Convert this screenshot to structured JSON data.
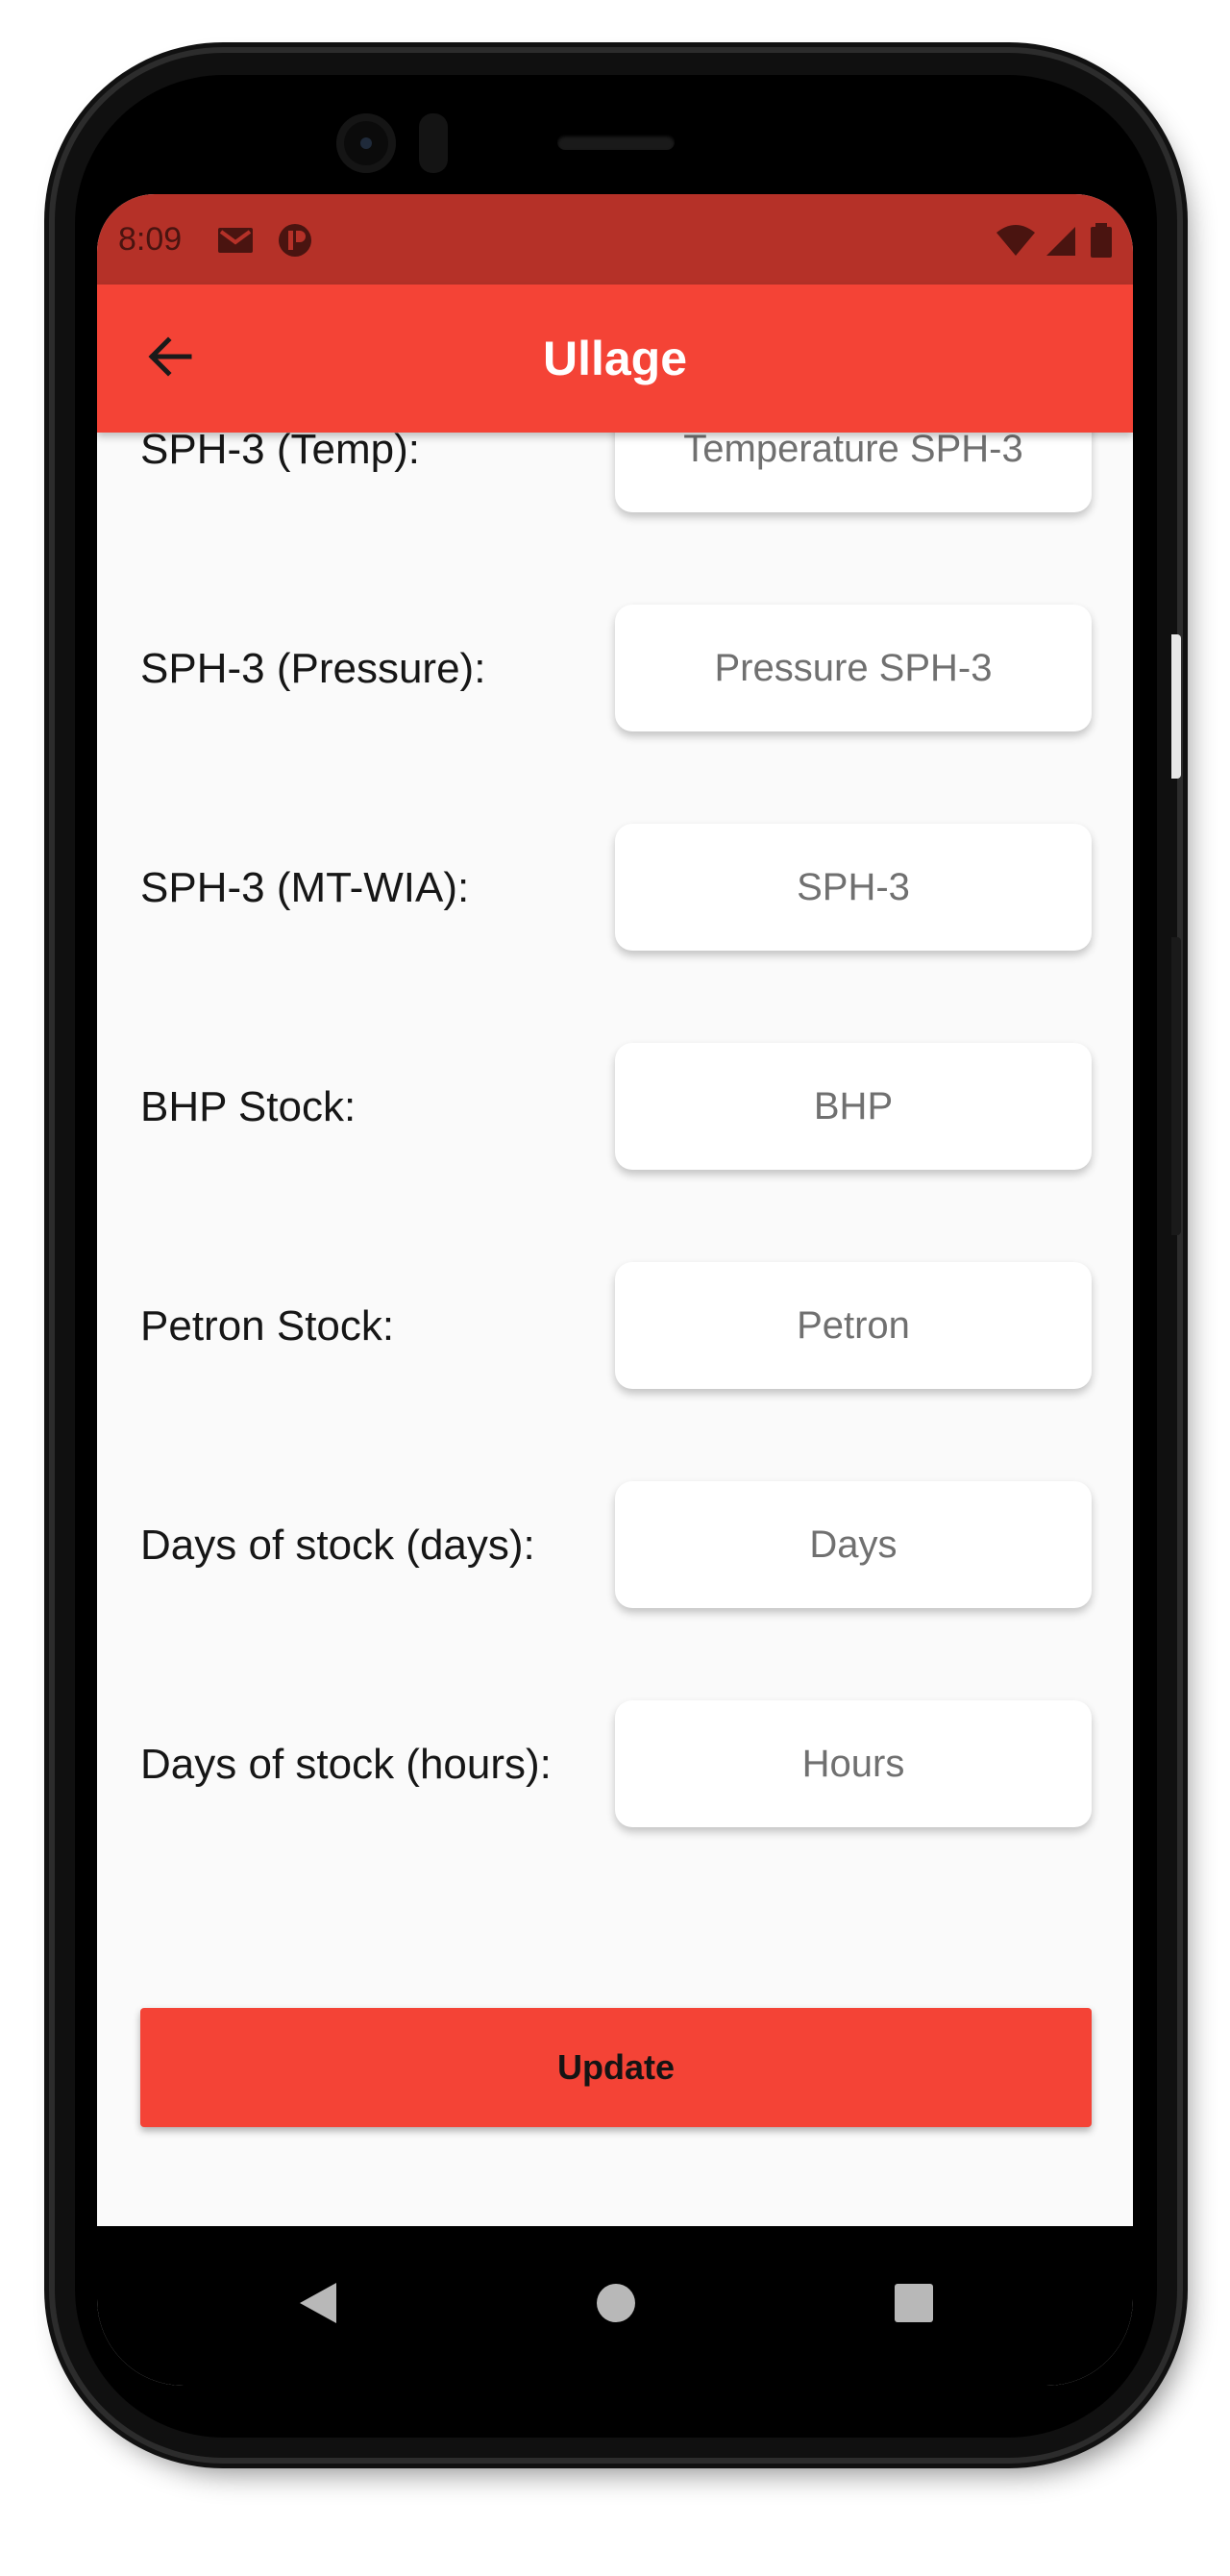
{
  "status_bar": {
    "time": "8:09",
    "left_icons": [
      "gmail-icon",
      "app-notification-icon"
    ],
    "right_icons": [
      "wifi-icon",
      "cellular-signal-icon",
      "battery-icon"
    ]
  },
  "app_bar": {
    "title": "Ullage",
    "back_icon": "arrow-back-icon",
    "color": "#f44336",
    "status_color": "#b53128"
  },
  "form": {
    "fields": [
      {
        "label": "SPH-3 (Temp):",
        "placeholder": "Temperature SPH-3",
        "value": ""
      },
      {
        "label": "SPH-3 (Pressure):",
        "placeholder": "Pressure SPH-3",
        "value": ""
      },
      {
        "label": "SPH-3 (MT-WIA):",
        "placeholder": "SPH-3",
        "value": ""
      },
      {
        "label": "BHP Stock:",
        "placeholder": "BHP",
        "value": ""
      },
      {
        "label": "Petron Stock:",
        "placeholder": "Petron",
        "value": ""
      },
      {
        "label": "Days of stock (days):",
        "placeholder": "Days",
        "value": ""
      },
      {
        "label": "Days of stock (hours):",
        "placeholder": "Hours",
        "value": ""
      }
    ]
  },
  "update_button": {
    "label": "Update",
    "color": "#f44336"
  },
  "nav_bar": {
    "icons": [
      "nav-back-icon",
      "nav-home-icon",
      "nav-recents-icon"
    ]
  }
}
